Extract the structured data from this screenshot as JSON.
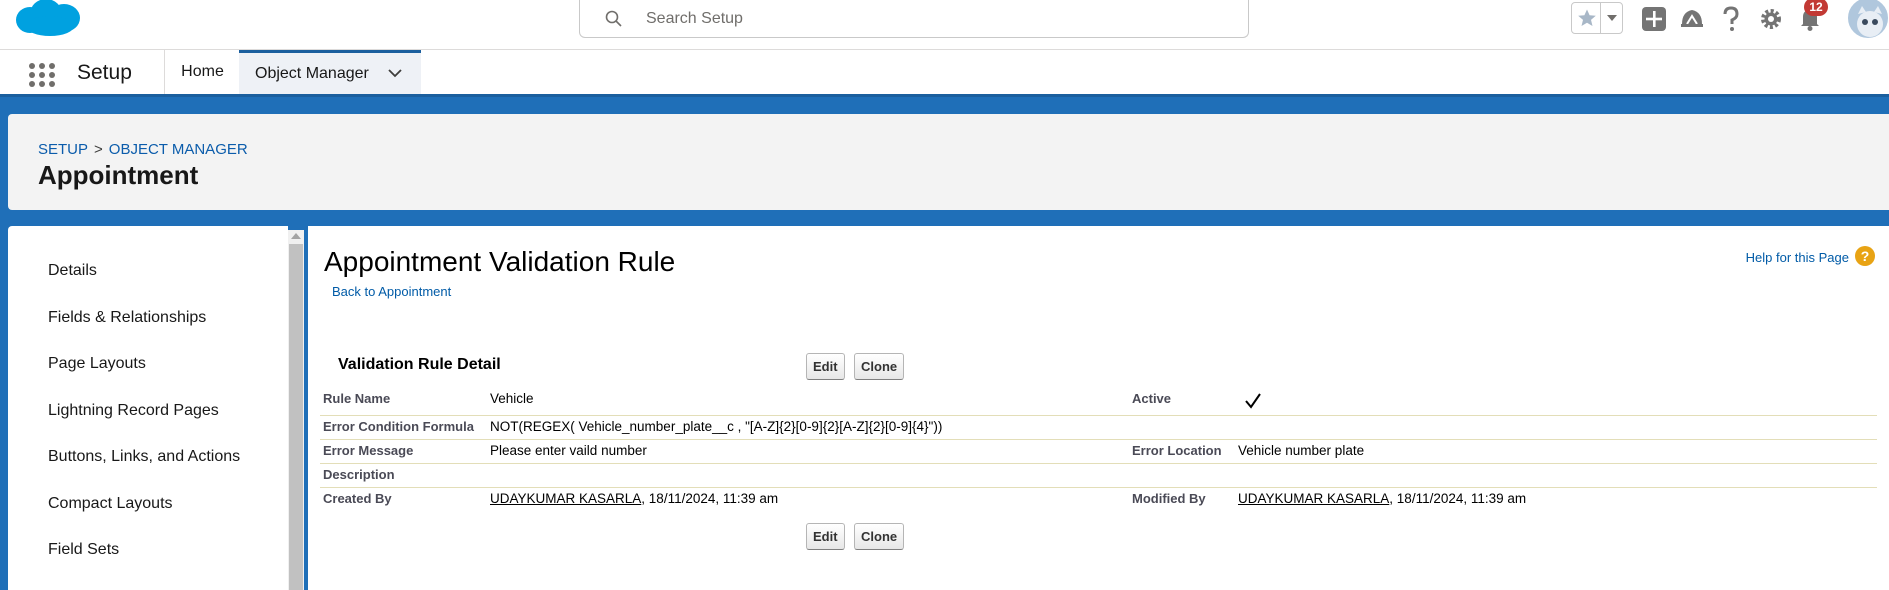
{
  "header": {
    "search_placeholder": "Search Setup",
    "notification_count": "12",
    "icons": [
      "salesforce-cloud-logo",
      "search-icon",
      "star-icon",
      "chevron-down-icon",
      "add-icon",
      "trailhead-icon",
      "help-icon",
      "gear-icon",
      "bell-icon",
      "avatar"
    ]
  },
  "appbar": {
    "app_name": "Setup",
    "tabs": [
      {
        "label": "Home"
      },
      {
        "label": "Object Manager"
      }
    ]
  },
  "page_header": {
    "breadcrumb": [
      "SETUP",
      ">",
      "OBJECT MANAGER"
    ],
    "title": "Appointment"
  },
  "sidebar": {
    "items": [
      {
        "label": "Details"
      },
      {
        "label": "Fields & Relationships"
      },
      {
        "label": "Page Layouts"
      },
      {
        "label": "Lightning Record Pages"
      },
      {
        "label": "Buttons, Links, and Actions"
      },
      {
        "label": "Compact Layouts"
      },
      {
        "label": "Field Sets"
      }
    ]
  },
  "main": {
    "title": "Appointment Validation Rule",
    "back_link": "Back to Appointment",
    "help_link": "Help for this Page",
    "section_title": "Validation Rule Detail",
    "buttons": {
      "edit": "Edit",
      "clone": "Clone"
    },
    "fields": {
      "rule_name_label": "Rule Name",
      "rule_name": "Vehicle",
      "active_label": "Active",
      "active": true,
      "error_condition_label": "Error Condition Formula",
      "error_condition": "NOT(REGEX( Vehicle_number_plate__c , \"[A-Z]{2}[0-9]{2}[A-Z]{2}[0-9]{4}\"))",
      "error_message_label": "Error Message",
      "error_message": "Please enter vaild number",
      "error_location_label": "Error Location",
      "error_location": "Vehicle number plate",
      "description_label": "Description",
      "description": "",
      "created_by_label": "Created By",
      "created_by_name": "UDAYKUMAR KASARLA",
      "created_by_date": ", 18/11/2024, 11:39 am",
      "modified_by_label": "Modified By",
      "modified_by_name": "UDAYKUMAR KASARLA",
      "modified_by_date": ", 18/11/2024, 11:39 am"
    }
  },
  "colors": {
    "brand_blue": "#1b5f9e",
    "link_blue": "#015ba7",
    "background_blue": "#1f6fb8",
    "notification_red": "#c23934"
  }
}
